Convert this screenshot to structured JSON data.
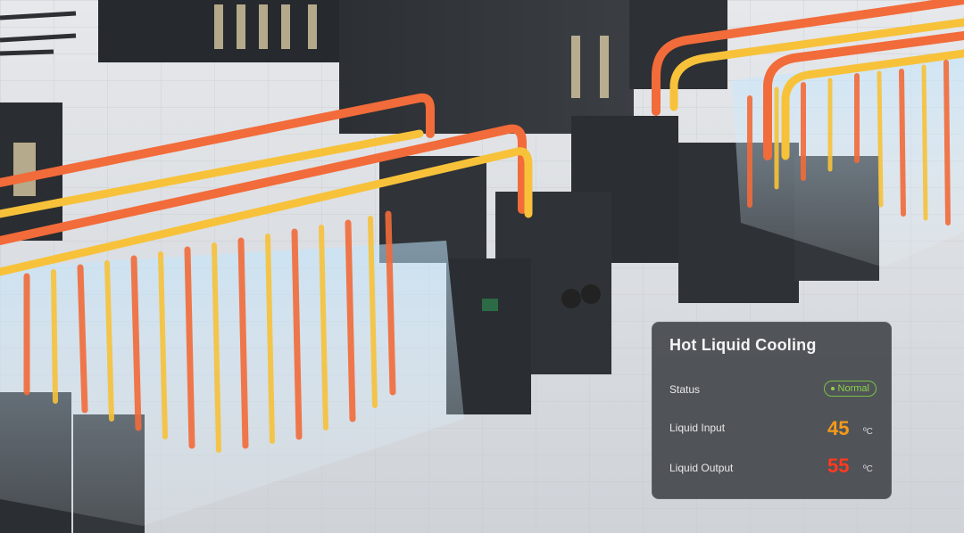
{
  "panel": {
    "title": "Hot Liquid Cooling",
    "status_label": "Status",
    "status_value": "Normal",
    "input_label": "Liquid Input",
    "input_value": "45",
    "input_unit": "ºC",
    "output_label": "Liquid Output",
    "output_value": "55",
    "output_unit": "ºC"
  },
  "colors": {
    "status_ok": "#8bd34a",
    "input_value": "#f59a1a",
    "output_value": "#ff3b1f",
    "pipe_hot": "#f26b3a",
    "pipe_warm": "#f7c23a",
    "panel_bg": "#3a3e42"
  }
}
